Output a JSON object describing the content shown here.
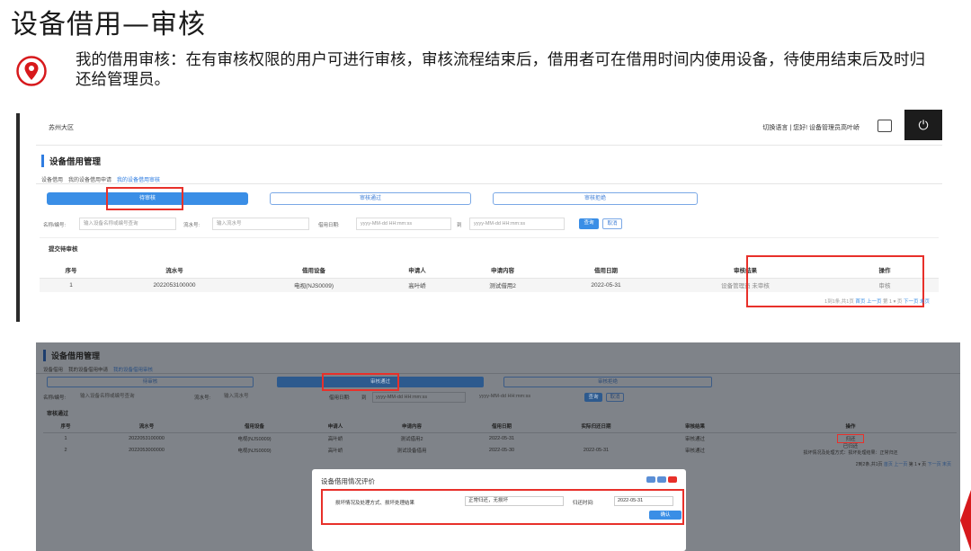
{
  "slide": {
    "title": "设备借用—审核",
    "description": "我的借用审核：在有审核权限的用户可进行审核，审核流程结束后，借用者可在借用时间内使用设备，待使用结束后及时归还给管理员。"
  },
  "shot1": {
    "site": "苏州大区",
    "user_info": "切换语言 | 您好! 设备管理员高叶峤",
    "power_icon": "⏻",
    "heading": "设备借用管理",
    "tabs": [
      "设备借用",
      "我的设备借用申请",
      "我的设备借用审核"
    ],
    "status_buttons": [
      "待审核",
      "审核通过",
      "审核拒绝"
    ],
    "filter": {
      "name_label": "名称/编号:",
      "name_placeholder": "输入设备名称或编号查询",
      "serial_label": "流水号:",
      "serial_placeholder": "输入流水号",
      "date_label": "借用日期:",
      "date_start": "yyyy-MM-dd HH:mm:ss",
      "to": "到",
      "date_end": "yyyy-MM-dd HH:mm:ss",
      "search": "查询",
      "cancel": "取消"
    },
    "section_title": "提交待审核",
    "columns": [
      "序号",
      "流水号",
      "借用设备",
      "申请人",
      "申请内容",
      "借用日期",
      "审核结果",
      "操作"
    ],
    "rows": [
      [
        "1",
        "2022053100000",
        "电视(NJS0009)",
        "高叶峤",
        "测试借用2",
        "2022-05-31",
        "设备管理员 未审核",
        "审核"
      ]
    ],
    "pager": {
      "summary": "1到1条,共1页",
      "first": "首页",
      "prev": "上一页",
      "page": "第 1 ▾ 页",
      "next": "下一页",
      "last": "末页"
    }
  },
  "shot2": {
    "heading": "设备借用管理",
    "tabs": [
      "设备借用",
      "我的设备借用申请",
      "我的设备借用审核"
    ],
    "status_buttons": [
      "待审核",
      "审核通过",
      "审核拒绝"
    ],
    "filter": {
      "name_label": "名称/编号:",
      "name_placeholder": "输入设备名称或编号查询",
      "serial_label": "流水号:",
      "serial_placeholder": "输入流水号",
      "date_label": "借用日期:",
      "to": "到",
      "date_start": "yyyy-MM-dd HH:mm:ss",
      "date_end": "yyyy-MM-dd HH:mm:ss",
      "search": "查询",
      "cancel": "取消"
    },
    "section_title": "审核通过",
    "columns": [
      "序号",
      "流水号",
      "借用设备",
      "申请人",
      "申请内容",
      "借用日期",
      "实际归还日期",
      "审核结果",
      "操作"
    ],
    "rows": [
      [
        "1",
        "2022053100000",
        "电视(NJS0009)",
        "高叶峤",
        "测试借用2",
        "2022-05-31",
        "",
        "审核通过",
        "归还"
      ],
      [
        "2",
        "2022053000000",
        "电视(NJS0009)",
        "高叶峤",
        "测试设备借用",
        "2022-05-30",
        "2022-05-31",
        "审核通过",
        "已归还"
      ]
    ],
    "row2_note": "损坏情况及处理方式：损坏处理结果：正常归还",
    "pager": {
      "summary": "2到2条,共1页",
      "first": "首页",
      "prev": "上一页",
      "page": "第 1 ▾ 页",
      "next": "下一页",
      "last": "末页"
    }
  },
  "dialog": {
    "title": "设备借用情况评价",
    "damage_label": "损坏情况及处理方式、损坏处理结果",
    "damage_value": "正常归还，无损坏",
    "return_label": "归还时间:",
    "return_value": "2022-05-31",
    "ok": "确认"
  },
  "colors": {
    "accent": "#3a8ee6",
    "highlight": "#e8302a"
  }
}
